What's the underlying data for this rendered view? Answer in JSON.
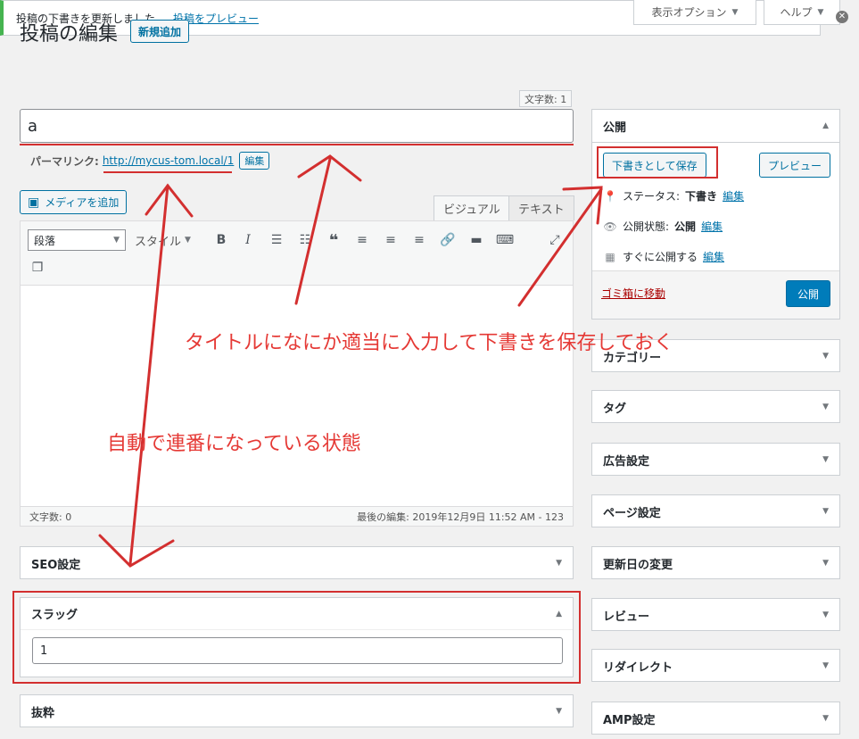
{
  "header": {
    "title": "投稿の編集",
    "add_new": "新規追加",
    "screen_options": "表示オプション",
    "help": "ヘルプ"
  },
  "notice": {
    "message": "投稿の下書きを更新しました。",
    "preview_link": "投稿をプレビュー"
  },
  "title_field": {
    "char_count": "文字数: 1",
    "value": "a"
  },
  "permalink": {
    "label": "パーマリンク:",
    "url": "http://mycus-tom.local/1",
    "edit": "編集"
  },
  "editor": {
    "add_media": "メディアを追加",
    "tabs": [
      "ビジュアル",
      "テキスト"
    ],
    "format": "段落",
    "style": "スタイル",
    "word_count": "文字数: 0",
    "last_edited": "最後の編集: 2019年12月9日 11:52 AM - 123"
  },
  "publish": {
    "title": "公開",
    "save_draft": "下書きとして保存",
    "preview": "プレビュー",
    "status_label": "ステータス:",
    "status_value": "下書き",
    "visibility_label": "公開状態:",
    "visibility_value": "公開",
    "schedule_label": "すぐに公開する",
    "edit": "編集",
    "trash": "ゴミ箱に移動",
    "publish": "公開"
  },
  "side_boxes": [
    "カテゴリー",
    "タグ",
    "広告設定",
    "ページ設定",
    "更新日の変更",
    "レビュー",
    "リダイレクト",
    "AMP設定"
  ],
  "main_boxes": {
    "seo": "SEO設定",
    "slug": "スラッグ",
    "slug_value": "1",
    "excerpt": "抜粋"
  },
  "annotations": {
    "save_note": "タイトルになにか適当に入力して下書きを保存しておく",
    "auto_note": "自動で連番になっている状態"
  },
  "colors": {
    "accent": "#0073aa",
    "annotation": "#e53935",
    "notice": "#46b450"
  }
}
